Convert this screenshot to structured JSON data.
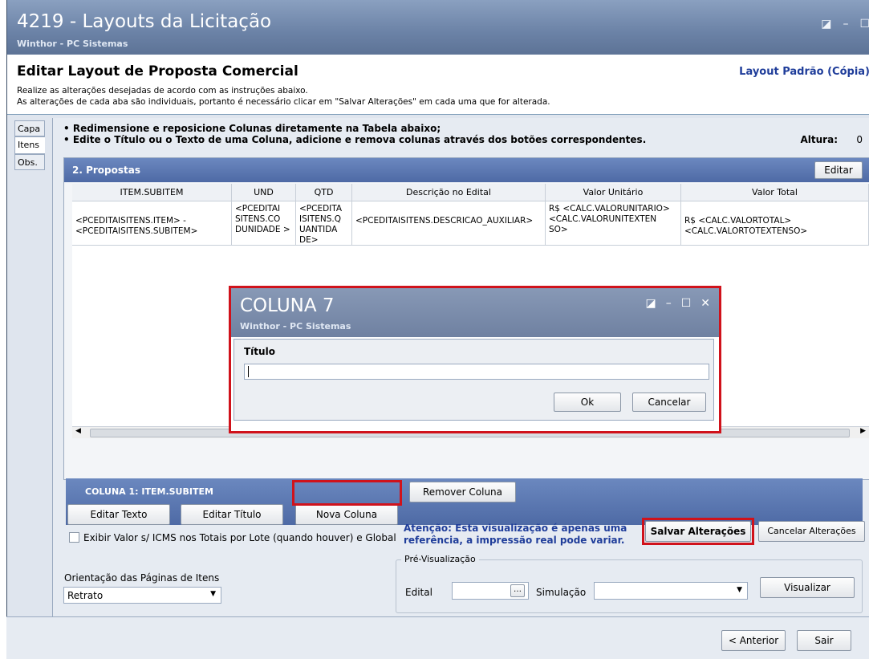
{
  "window": {
    "title": "4219 - Layouts da Licitação",
    "subtitle": "Winthor - PC Sistemas"
  },
  "header": {
    "title": "Editar Layout de Proposta Comercial",
    "layout_name": "Layout Padrão (Cópia)",
    "instruction_1": "Realize as alterações desejadas de acordo com as instruções abaixo.",
    "instruction_2": "As alterações de cada aba são individuais, portanto é necessário clicar em \"Salvar Alterações\" em cada uma que for alterada."
  },
  "tabs": [
    "Capa",
    "Itens",
    "Obs."
  ],
  "bullets": [
    "• Redimensione e reposicione Colunas diretamente na Tabela abaixo;",
    "• Edite o Título ou o Texto de uma Coluna, adicione e remova colunas  através dos botões correspondentes."
  ],
  "altura": {
    "label": "Altura:",
    "value": "0"
  },
  "panel": {
    "title": "2. Propostas",
    "edit_button": "Editar"
  },
  "table": {
    "headers": [
      "ITEM.SUBITEM",
      "UND",
      "QTD",
      "Descrição no Edital",
      "Valor Unitário",
      "Valor Total"
    ],
    "cells": [
      "<PCEDITAISITENS.ITEM> - <PCEDITAISITENS.SUBITEM>",
      "<PCEDITAI SITENS.CO DUNIDADE >",
      "<PCEDITA ISITENS.Q UANTIDA DE>",
      "<PCEDITAISITENS.DESCRICAO_AUXILIAR>",
      "R$ <CALC.VALORUNITARIO> <CALC.VALORUNITEXTEN SO>",
      "R$ <CALC.VALORTOTAL> <CALC.VALORTOTEXTENSO>"
    ],
    "scroll_grip": "III"
  },
  "dialog": {
    "title": "COLUNA 7",
    "subtitle": "Winthor - PC Sistemas",
    "field_label": "Título",
    "field_value": "",
    "ok_label": "Ok",
    "cancel_label": "Cancelar"
  },
  "column_bar": {
    "title": "COLUNA 1: ITEM.SUBITEM",
    "buttons": [
      "Editar Texto",
      "Editar Título",
      "Nova Coluna",
      "Remover Coluna"
    ]
  },
  "options": {
    "checkbox_label": "Exibir Valor s/ ICMS nos Totais por Lote (quando houver) e Global",
    "checkbox_checked": false,
    "orientation_label": "Orientação das Páginas de Itens",
    "orientation_value": "Retrato"
  },
  "warning": {
    "line1": "Atenção: Esta visualização é apenas uma",
    "line2": "referência, a impressão real pode variar."
  },
  "save_button": "Salvar Alterações",
  "cancel_changes_button": "Cancelar Alterações",
  "preview": {
    "group_title": "Pré-Visualização",
    "edital_label": "Edital",
    "edital_value": "",
    "simulacao_label": "Simulação",
    "simulacao_value": "",
    "visualizar_button": "Visualizar"
  },
  "footer": {
    "previous_button": "< Anterior",
    "exit_button": "Sair"
  },
  "icons": {
    "window_controls": [
      "restore-icon",
      "minimize-icon",
      "maximize-icon"
    ],
    "dialog_controls": [
      "restore-icon",
      "minimize-icon",
      "maximize-icon",
      "close-icon"
    ]
  },
  "colors": {
    "title_bar": "#6b82a6",
    "panel_header": "#4e6aa5",
    "highlight_border": "#d0121b",
    "link_blue": "#1f3d9a"
  }
}
